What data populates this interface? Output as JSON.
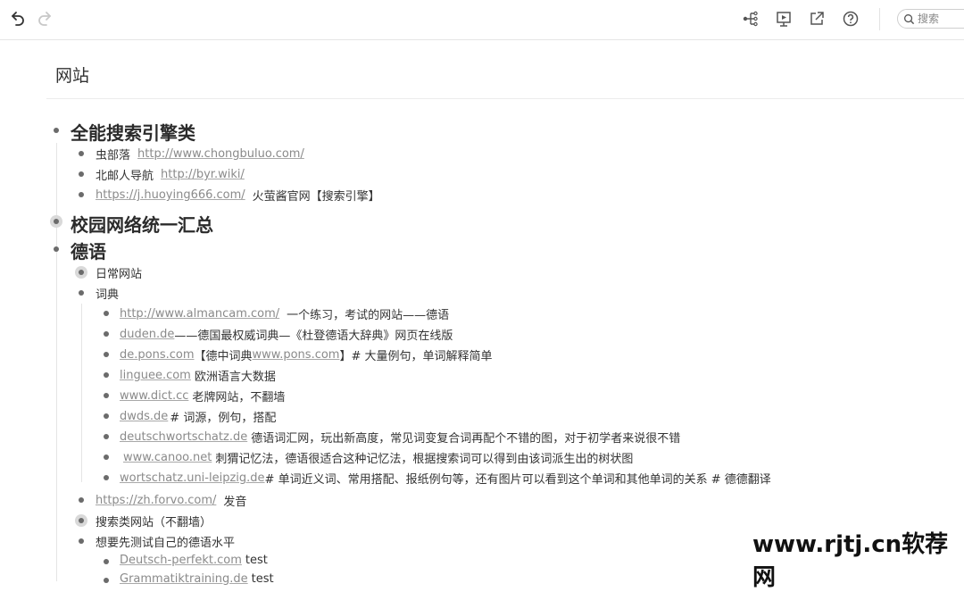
{
  "toolbar": {
    "undo_icon": "undo-icon",
    "redo_icon": "redo-icon",
    "right_icons": [
      "mindmap-icon",
      "presentation-icon",
      "export-icon",
      "help-icon"
    ],
    "search_placeholder": "搜索"
  },
  "page": {
    "title": "网站"
  },
  "outline": {
    "sec1": {
      "title": "全能搜索引擎类",
      "i1_text": "虫部落",
      "i1_link": "http://www.chongbuluo.com/",
      "i2_text": "北邮人导航",
      "i2_link": "http://byr.wiki/",
      "i3_link": "https://j.huoying666.com/",
      "i3_text": "火萤酱官网【搜索引擎】"
    },
    "sec2": {
      "title": "校园网络统一汇总",
      "collapsed": true
    },
    "sec3": {
      "title": "德语",
      "daily": {
        "text": "日常网站",
        "collapsed": true
      },
      "dict": {
        "text": "词典",
        "items": [
          {
            "link": "http://www.almancam.com/",
            "text": "一个练习，考试的网站——德语"
          },
          {
            "link": "duden.de",
            "text": "——德国最权威词典—《杜登德语大辞典》网页在线版"
          },
          {
            "link": "de.pons.com",
            "text": "【德中词典",
            "link2": "www.pons.com",
            "text2": "】# 大量例句，单词解释简单"
          },
          {
            "link": "linguee.com",
            "text": "欧洲语言大数据"
          },
          {
            "link": "www.dict.cc",
            "text": "老牌网站，不翻墙"
          },
          {
            "link": "dwds.de",
            "text": "# 词源，例句，搭配"
          },
          {
            "link": "deutschwortschatz.de",
            "text": "德语词汇网，玩出新高度，常见词变复合词再配个不错的图，对于初学者来说很不错"
          },
          {
            "link": "www.canoo.net",
            "text": "刺猬记忆法，德语很适合这种记忆法，根据搜索词可以得到由该词派生出的树状图"
          },
          {
            "link": "wortschatz.uni-leipzig.de",
            "text": "# 单词近义词、常用搭配、报纸例句等，还有图片可以看到这个单词和其他单词的关系 # 德德翻译"
          }
        ]
      },
      "forvo": {
        "link": "https://zh.forvo.com/",
        "text": "发音"
      },
      "search_sites": {
        "text": "搜索类网站（不翻墙）",
        "collapsed": true
      },
      "test": {
        "text": "想要先测试自己的德语水平",
        "items": [
          {
            "link": "Deutsch-perfekt.com",
            "text": "test"
          },
          {
            "link": "Grammatiktraining.de",
            "text": "test"
          }
        ]
      }
    }
  },
  "watermark": "www.rjtj.cn软荐网",
  "colors": {
    "link": "#8a8a8a",
    "text": "#333333",
    "bullet": "#6b6b6b",
    "collapsed_ring": "#d9d9d9"
  }
}
